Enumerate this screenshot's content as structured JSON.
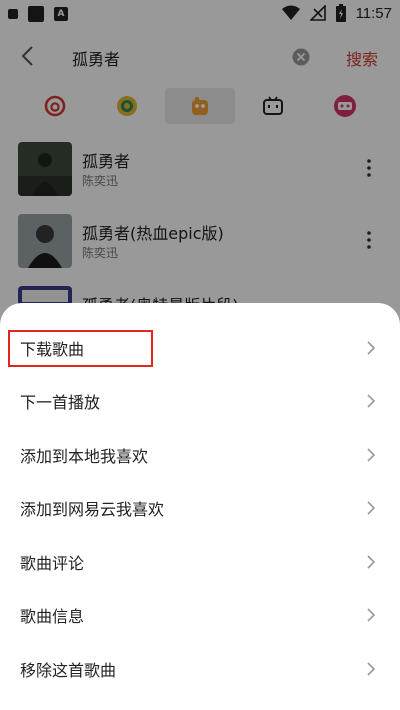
{
  "status_bar": {
    "time": "11:57",
    "app_icon_letter": "A"
  },
  "search": {
    "query": "孤勇者",
    "search_button_label": "搜索"
  },
  "sources": [
    {
      "icon": "netease-cloud-music-icon",
      "color": "#d33a31",
      "active": false
    },
    {
      "icon": "qq-music-icon",
      "color": "#e0b63a",
      "active": false
    },
    {
      "icon": "kuwo-music-icon",
      "color": "#f0a030",
      "active": true
    },
    {
      "icon": "bilibili-icon",
      "color": "#222222",
      "active": false
    },
    {
      "icon": "migu-music-icon",
      "color": "#d6336c",
      "active": false
    }
  ],
  "songs": [
    {
      "title": "孤勇者",
      "artist": "陈奕迅"
    },
    {
      "title": "孤勇者(热血epic版)",
      "artist": "陈奕迅"
    },
    {
      "title": "孤勇者(奥特曼版片段)",
      "artist": ""
    }
  ],
  "menu": {
    "items": [
      {
        "label": "下载歌曲",
        "highlighted": true
      },
      {
        "label": "下一首播放"
      },
      {
        "label": "添加到本地我喜欢"
      },
      {
        "label": "添加到网易云我喜欢"
      },
      {
        "label": "歌曲评论"
      },
      {
        "label": "歌曲信息"
      },
      {
        "label": "移除这首歌曲"
      }
    ]
  },
  "colors": {
    "accent": "#d33a31",
    "highlight_box": "#e0261f"
  }
}
